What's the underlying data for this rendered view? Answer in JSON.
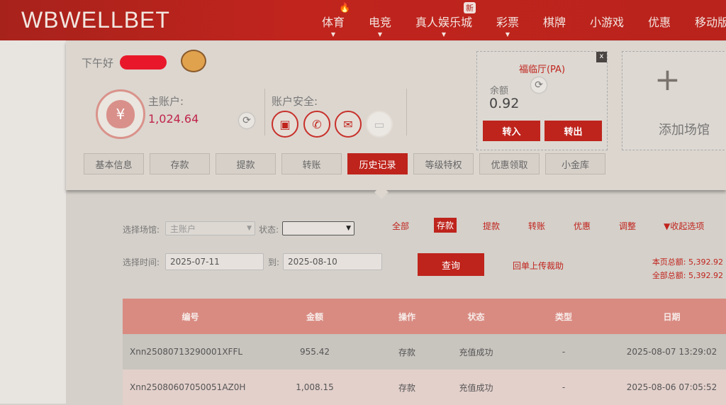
{
  "header": {
    "logo": "WBWELLBET",
    "nav": [
      {
        "label": "体育",
        "caret": true
      },
      {
        "label": "电竞",
        "caret": true
      },
      {
        "label": "真人娱乐城",
        "caret": true,
        "badge": "新"
      },
      {
        "label": "彩票",
        "caret": true
      },
      {
        "label": "棋牌"
      },
      {
        "label": "小游戏"
      },
      {
        "label": "优惠"
      },
      {
        "label": "移动版"
      }
    ]
  },
  "account": {
    "greeting": "下午好",
    "main_label": "主账户:",
    "main_balance": "1,024.64",
    "security_label": "账户安全:",
    "security_icons": [
      "id-card-icon",
      "sms-phone-icon",
      "email-icon",
      "bank-card-icon"
    ]
  },
  "tabs": [
    "基本信息",
    "存款",
    "提款",
    "转账",
    "历史记录",
    "等级特权",
    "优惠领取",
    "小金库"
  ],
  "active_tab": 4,
  "venue": {
    "name": "福临厅(PA)",
    "close": "x",
    "balance_label": "余额",
    "balance": "0.92",
    "in": "转入",
    "out": "转出"
  },
  "add_venue": {
    "plus": "+",
    "label": "添加场馆"
  },
  "filters": {
    "venue_label": "选择场馆:",
    "venue_value": "主账户",
    "status_label": "状态:",
    "status_value": "",
    "time_label": "选择时间:",
    "from": "2025-07-11",
    "to_label": "到:",
    "to": "2025-08-10",
    "query": "查询",
    "types": [
      "全部",
      "存款",
      "提款",
      "转账",
      "优惠",
      "调整"
    ],
    "active_type": 1,
    "collapse": "▼收起选项",
    "upload": "回单上传裁助",
    "page_total": "本页总额: 5,392.92",
    "all_total": "全部总额: 5,392.92"
  },
  "table": {
    "columns": [
      "编号",
      "金额",
      "操作",
      "状态",
      "类型",
      "日期"
    ],
    "rows": [
      [
        "Xnn25080713290001XFFL",
        "955.42",
        "存款",
        "充值成功",
        "-",
        "2025-08-07 13:29:02"
      ],
      [
        "Xnn25080607050051AZ0H",
        "1,008.15",
        "存款",
        "充值成功",
        "-",
        "2025-08-06 07:05:52"
      ]
    ]
  },
  "colors": {
    "brand": "#be241c",
    "table_header": "#d98b82"
  }
}
